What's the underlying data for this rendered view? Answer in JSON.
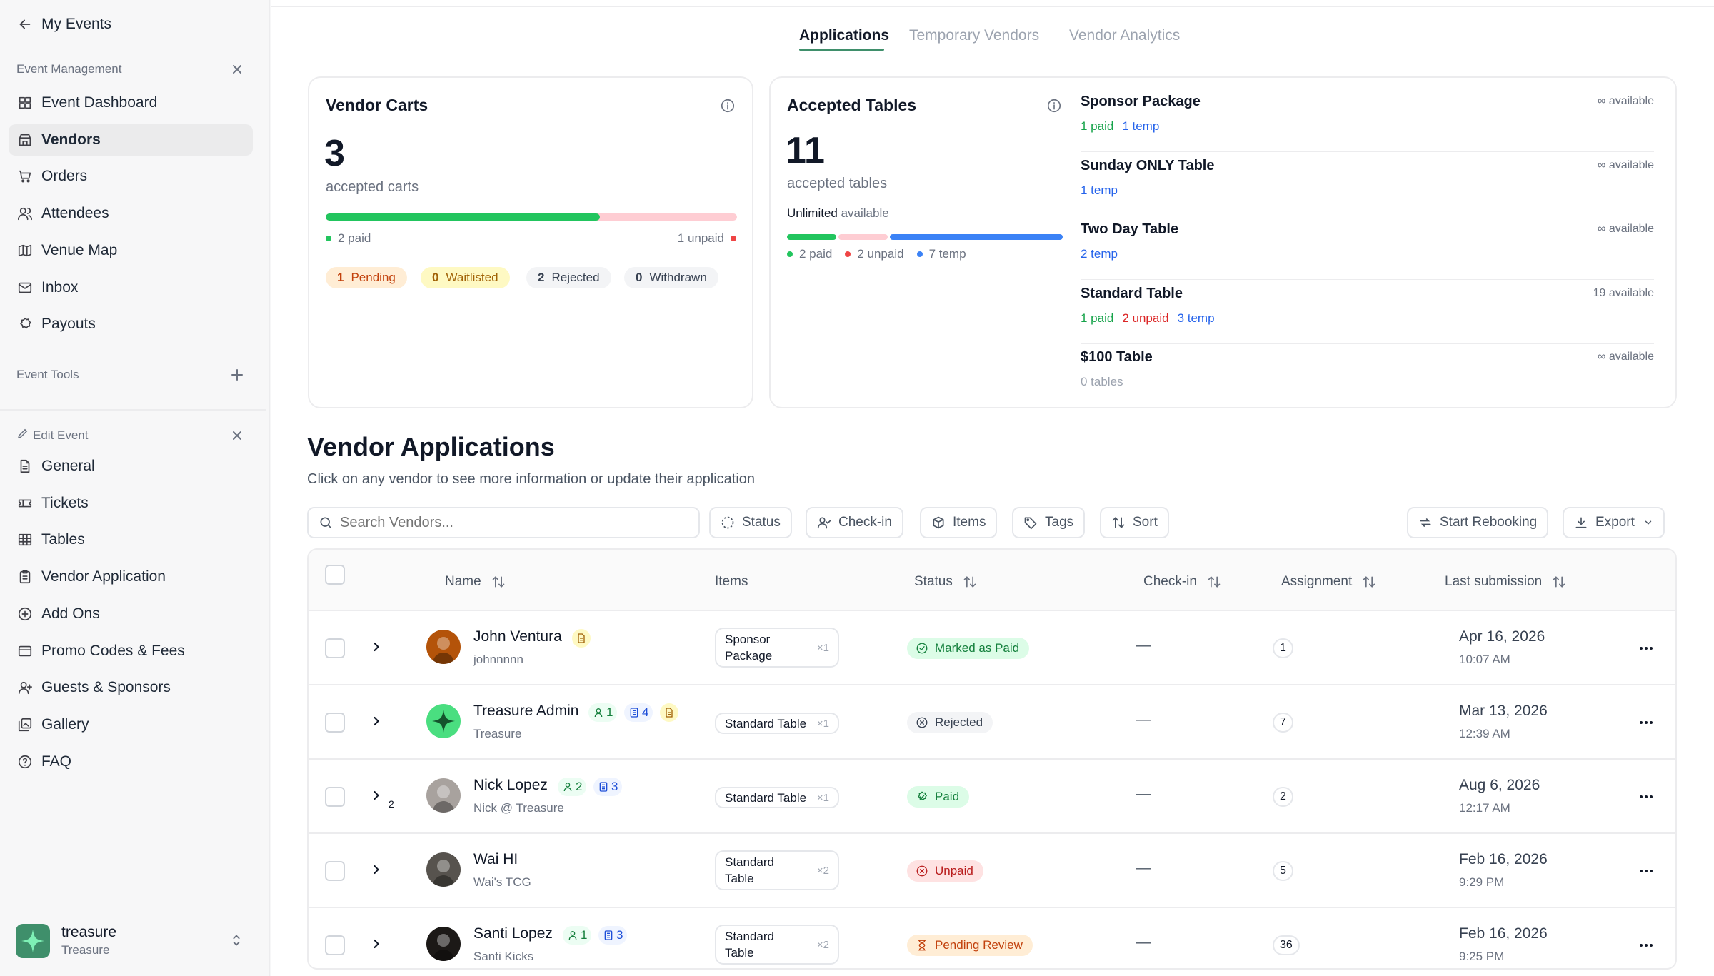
{
  "sidebar": {
    "back_label": "My Events",
    "event_management_label": "Event Management",
    "management_items": [
      {
        "label": "Event Dashboard",
        "icon": "grid-icon"
      },
      {
        "label": "Vendors",
        "icon": "store-icon",
        "active": true
      },
      {
        "label": "Orders",
        "icon": "cart-icon"
      },
      {
        "label": "Attendees",
        "icon": "users-icon"
      },
      {
        "label": "Venue Map",
        "icon": "map-icon"
      },
      {
        "label": "Inbox",
        "icon": "mail-icon"
      },
      {
        "label": "Payouts",
        "icon": "badge-icon"
      }
    ],
    "event_tools_label": "Event Tools",
    "edit_event_label": "Edit Event",
    "edit_items": [
      {
        "label": "General",
        "icon": "document-icon"
      },
      {
        "label": "Tickets",
        "icon": "ticket-icon"
      },
      {
        "label": "Tables",
        "icon": "table-icon"
      },
      {
        "label": "Vendor Application",
        "icon": "clipboard-icon"
      },
      {
        "label": "Add Ons",
        "icon": "plus-circle-icon"
      },
      {
        "label": "Promo Codes & Fees",
        "icon": "card-icon"
      },
      {
        "label": "Guests & Sponsors",
        "icon": "user-plus-icon"
      },
      {
        "label": "Gallery",
        "icon": "gallery-icon"
      },
      {
        "label": "FAQ",
        "icon": "help-icon"
      }
    ],
    "account": {
      "name": "treasure",
      "org": "Treasure"
    }
  },
  "tabs": [
    {
      "label": "Applications",
      "active": true
    },
    {
      "label": "Temporary Vendors",
      "active": false
    },
    {
      "label": "Vendor Analytics",
      "active": false
    }
  ],
  "vendor_carts": {
    "title": "Vendor Carts",
    "count": "3",
    "count_label": "accepted carts",
    "paid_label": "2 paid",
    "unpaid_label": "1 unpaid",
    "paid_fraction": 0.667,
    "pills": [
      {
        "count": "1",
        "label": "Pending"
      },
      {
        "count": "0",
        "label": "Waitlisted"
      },
      {
        "count": "2",
        "label": "Rejected"
      },
      {
        "count": "0",
        "label": "Withdrawn"
      }
    ]
  },
  "accepted_tables": {
    "title": "Accepted Tables",
    "count": "11",
    "count_label": "accepted tables",
    "availability_strong": "Unlimited",
    "availability_rest": "available",
    "paid_label": "2 paid",
    "unpaid_label": "2 unpaid",
    "temp_label": "7 temp",
    "paid": 2,
    "unpaid": 2,
    "temp": 7,
    "table_types": [
      {
        "name": "Sponsor Package",
        "available": "∞ available",
        "tags": [
          {
            "text": "1 paid",
            "color": "green"
          },
          {
            "text": "1 temp",
            "color": "blue"
          }
        ]
      },
      {
        "name": "Sunday ONLY Table",
        "available": "∞ available",
        "tags": [
          {
            "text": "1 temp",
            "color": "blue"
          }
        ]
      },
      {
        "name": "Two Day Table",
        "available": "∞ available",
        "tags": [
          {
            "text": "2 temp",
            "color": "blue"
          }
        ]
      },
      {
        "name": "Standard Table",
        "available": "19 available",
        "tags": [
          {
            "text": "1 paid",
            "color": "green"
          },
          {
            "text": "2 unpaid",
            "color": "red"
          },
          {
            "text": "3 temp",
            "color": "blue"
          }
        ]
      },
      {
        "name": "$100 Table",
        "available": "∞ available",
        "tags": [
          {
            "text": "0 tables",
            "color": "gray"
          }
        ]
      }
    ]
  },
  "applications": {
    "title": "Vendor Applications",
    "subtitle": "Click on any vendor to see more information or update their application",
    "search_placeholder": "Search Vendors...",
    "filters": [
      "Status",
      "Check-in",
      "Items",
      "Tags",
      "Sort"
    ],
    "start_rebooking": "Start Rebooking",
    "export": "Export",
    "columns": {
      "name": "Name",
      "items": "Items",
      "status": "Status",
      "checkin": "Check-in",
      "assignment": "Assignment",
      "last_submission": "Last submission"
    },
    "rows": [
      {
        "name": "John Ventura",
        "sub": "johnnnnn",
        "members": "",
        "docs": "",
        "note": true,
        "item": "Sponsor Package",
        "qty": "×1",
        "status": "Marked as Paid",
        "status_color": "green",
        "status_icon": "check-circle-icon",
        "checkin": "—",
        "assignment": "1",
        "date": "Apr 16, 2026",
        "time": "10:07 AM",
        "expand_count": "",
        "avatar": "photo"
      },
      {
        "name": "Treasure Admin",
        "sub": "Treasure",
        "members": "1",
        "docs": "4",
        "note": true,
        "item": "Standard Table",
        "qty": "×1",
        "status": "Rejected",
        "status_color": "gray",
        "status_icon": "x-circle-icon",
        "checkin": "—",
        "assignment": "7",
        "date": "Mar 13, 2026",
        "time": "12:39 AM",
        "expand_count": "",
        "avatar": "logo"
      },
      {
        "name": "Nick Lopez",
        "sub": "Nick @ Treasure",
        "members": "2",
        "docs": "3",
        "note": false,
        "item": "Standard Table",
        "qty": "×1",
        "status": "Paid",
        "status_color": "green",
        "status_icon": "check-badge-icon",
        "checkin": "—",
        "assignment": "2",
        "date": "Aug 6, 2026",
        "time": "12:17 AM",
        "expand_count": "2",
        "avatar": "photo"
      },
      {
        "name": "Wai HI",
        "sub": "Wai's TCG",
        "members": "",
        "docs": "",
        "note": false,
        "item": "Standard Table",
        "qty": "×2",
        "status": "Unpaid",
        "status_color": "red",
        "status_icon": "x-circle-icon",
        "checkin": "—",
        "assignment": "5",
        "date": "Feb 16, 2026",
        "time": "9:29 PM",
        "expand_count": "",
        "avatar": "photo"
      },
      {
        "name": "Santi Lopez",
        "sub": "Santi Kicks",
        "members": "1",
        "docs": "3",
        "note": false,
        "item": "Standard Table",
        "qty": "×2",
        "status": "Pending Review",
        "status_color": "amber",
        "status_icon": "hourglass-icon",
        "checkin": "—",
        "assignment": "36",
        "date": "Feb 16, 2026",
        "time": "9:25 PM",
        "expand_count": "",
        "avatar": "photo"
      }
    ]
  }
}
